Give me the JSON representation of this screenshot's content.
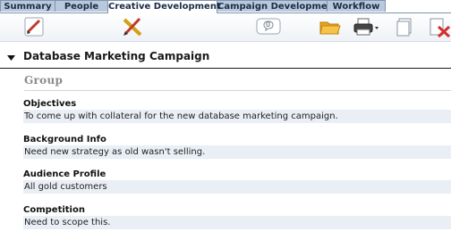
{
  "tabs": [
    {
      "label": "Summary",
      "active": false
    },
    {
      "label": "People",
      "active": false
    },
    {
      "label": "Creative Development",
      "active": true
    },
    {
      "label": "Campaign Development",
      "active": false
    },
    {
      "label": "Workflow",
      "active": false
    }
  ],
  "toolbar": {
    "icons": [
      "edit-icon",
      "design-tools-icon",
      "comment-icon",
      "open-folder-icon",
      "print-icon",
      "copy-icon",
      "delete-icon"
    ],
    "comment_count": "0"
  },
  "section": {
    "title": "Database Marketing Campaign",
    "group_label": "Group"
  },
  "fields": [
    {
      "label": "Objectives",
      "value": "To come up with collateral for the new database marketing campaign."
    },
    {
      "label": "Background Info",
      "value": "Need new strategy as old wasn't selling."
    },
    {
      "label": "Audience Profile",
      "value": "All gold customers"
    },
    {
      "label": "Competition",
      "value": "Need to scope this."
    }
  ],
  "colors": {
    "tab_bg": "#b9c9dd",
    "tab_active_bg": "#ffffff",
    "value_bg": "#e9eff5",
    "group_text": "#8a8a8a"
  }
}
